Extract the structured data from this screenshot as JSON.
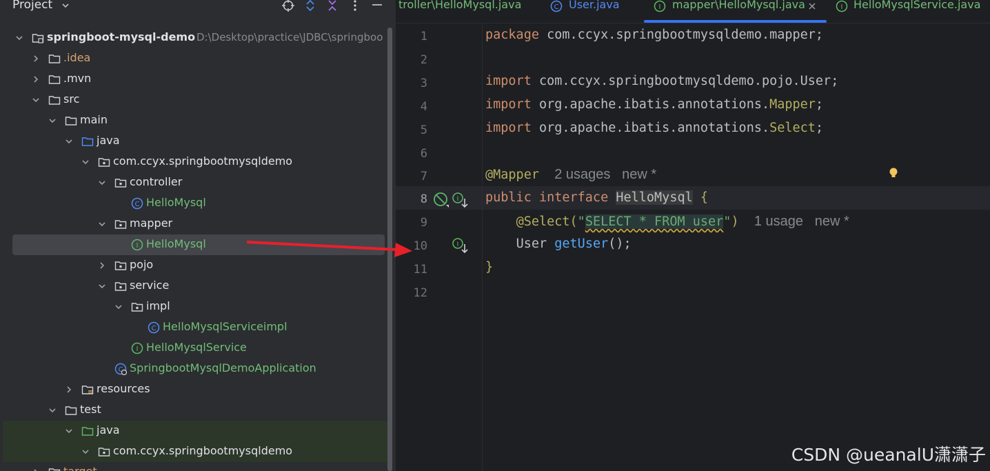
{
  "project_panel": {
    "title": "Project",
    "tree": [
      {
        "label": "springboot-mysql-demo",
        "path": "D:\\Desktop\\practice\\JDBC\\springboo",
        "icon": "module-folder-icon",
        "depth": 0,
        "expanded": true
      },
      {
        "label": ".idea",
        "icon": "folder-icon",
        "depth": 1,
        "expanded": false,
        "color": "orange"
      },
      {
        "label": ".mvn",
        "icon": "folder-icon",
        "depth": 1,
        "expanded": false
      },
      {
        "label": "src",
        "icon": "folder-icon",
        "depth": 1,
        "expanded": true
      },
      {
        "label": "main",
        "icon": "folder-icon",
        "depth": 2,
        "expanded": true
      },
      {
        "label": "java",
        "icon": "source-folder-icon",
        "depth": 3,
        "expanded": true
      },
      {
        "label": "com.ccyx.springbootmysqldemo",
        "icon": "package-icon",
        "depth": 4,
        "expanded": true
      },
      {
        "label": "controller",
        "icon": "package-icon",
        "depth": 5,
        "expanded": true
      },
      {
        "label": "HelloMysql",
        "icon": "class-icon",
        "depth": 6,
        "leaf": true,
        "color": "green"
      },
      {
        "label": "mapper",
        "icon": "package-icon",
        "depth": 5,
        "expanded": true
      },
      {
        "label": "HelloMysql",
        "icon": "interface-icon",
        "depth": 6,
        "leaf": true,
        "color": "green",
        "selected": true
      },
      {
        "label": "pojo",
        "icon": "package-icon",
        "depth": 5,
        "expanded": false
      },
      {
        "label": "service",
        "icon": "package-icon",
        "depth": 5,
        "expanded": true
      },
      {
        "label": "impl",
        "icon": "package-icon",
        "depth": 6,
        "expanded": true
      },
      {
        "label": "HelloMysqlServiceimpl",
        "icon": "class-icon",
        "depth": 7,
        "leaf": true,
        "color": "green"
      },
      {
        "label": "HelloMysqlService",
        "icon": "interface-icon",
        "depth": 6,
        "leaf": true,
        "color": "green"
      },
      {
        "label": "SpringbootMysqlDemoApplication",
        "icon": "spring-boot-class-icon",
        "depth": 5,
        "leaf": true,
        "color": "green"
      },
      {
        "label": "resources",
        "icon": "resources-folder-icon",
        "depth": 3,
        "expanded": false
      },
      {
        "label": "test",
        "icon": "folder-icon",
        "depth": 2,
        "expanded": true
      },
      {
        "label": "java",
        "icon": "test-source-folder-icon",
        "depth": 3,
        "expanded": true,
        "test": true
      },
      {
        "label": "com.ccyx.springbootmysqldemo",
        "icon": "package-icon",
        "depth": 4,
        "expanded": true,
        "test": true
      },
      {
        "label": "target",
        "icon": "folder-icon",
        "depth": 1,
        "expanded": false,
        "color": "orange",
        "partial": true
      }
    ]
  },
  "tabs": [
    {
      "label": "troller\\HelloMysql.java",
      "icon": "",
      "active": false
    },
    {
      "label": "User.java",
      "icon": "class-icon",
      "active": false
    },
    {
      "label": "mapper\\HelloMysql.java",
      "icon": "interface-icon",
      "active": true,
      "closable": true
    },
    {
      "label": "HelloMysqlService.java",
      "icon": "interface-icon",
      "active": false
    }
  ],
  "editor": {
    "line_numbers": [
      "1",
      "2",
      "3",
      "4",
      "5",
      "6",
      "7",
      "8",
      "9",
      "10",
      "11",
      "12"
    ],
    "active_line": "8",
    "code": {
      "l1_kw": "package",
      "l1_rest": " com.ccyx.springbootmysqldemo.mapper;",
      "l3_kw": "import",
      "l3_rest": " com.ccyx.springbootmysqldemo.pojo.User;",
      "l4_kw": "import",
      "l4_mid": " org.apache.ibatis.annotations.",
      "l4_ann": "Mapper",
      "l4_end": ";",
      "l5_kw": "import",
      "l5_mid": " org.apache.ibatis.annotations.",
      "l5_ann": "Select",
      "l5_end": ";",
      "l7_ann": "@Mapper",
      "l7_hint": "2 usages   new *",
      "l8_kw1": "public",
      "l8_kw2": "interface",
      "l8_name": "HelloMysql",
      "l8_brace": "{",
      "l9_ann": "@Select(",
      "l9_q1": "\"",
      "l9_sql": "SELECT * FROM user",
      "l9_q2": "\"",
      "l9_close": ")",
      "l9_hint": "1 usage   new *",
      "l10_type": "User ",
      "l10_fn": "getUser",
      "l10_end": "();",
      "l11_brace": "}"
    }
  },
  "watermark": "CSDN @ueanalU潇潇子",
  "colors": {
    "panel_bg": "#2b2d30",
    "editor_bg": "#1e1f22",
    "selection": "#43454a",
    "accent_blue": "#3574f0",
    "keyword": "#cf8e6d",
    "annotation": "#b3ae60",
    "string": "#6aab73",
    "function": "#56a8f5",
    "arrow_red": "#e8202a"
  }
}
